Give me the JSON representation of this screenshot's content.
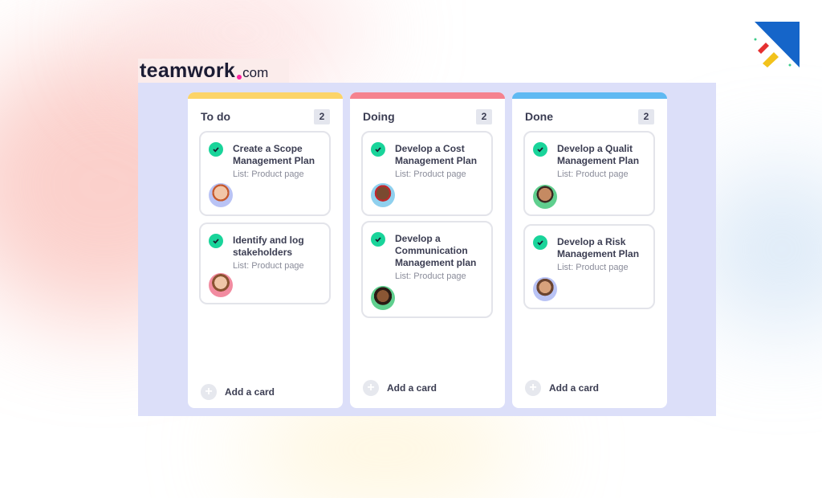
{
  "logo": {
    "word": "teamwork",
    "suffix": "com"
  },
  "brand_icon": "diagonal-stripes-logo",
  "colors": {
    "todo": "#fcd468",
    "doing": "#f5828f",
    "done": "#5fb9f2",
    "check": "#19d49a",
    "board_bg": "#dcdff9"
  },
  "columns": [
    {
      "title": "To do",
      "count": "2",
      "add_label": "Add a card",
      "cards": [
        {
          "title": "Create a Scope Management Plan",
          "list": "List: Product page",
          "avatar": "woman-red-hair-avatar"
        },
        {
          "title": "Identify and log stakeholders",
          "list": "List: Product page",
          "avatar": "woman-brown-hair-avatar"
        }
      ]
    },
    {
      "title": "Doing",
      "count": "2",
      "add_label": "Add a card",
      "cards": [
        {
          "title": "Develop a Cost Management Plan",
          "list": "List: Product page",
          "avatar": "man-smiling-avatar"
        },
        {
          "title": "Develop a Communication Management plan",
          "list": "List: Product page",
          "avatar": "woman-curly-hair-avatar"
        }
      ]
    },
    {
      "title": "Done",
      "count": "2",
      "add_label": "Add a card",
      "cards": [
        {
          "title": "Develop a Qualit Management Plan",
          "list": "List: Product page",
          "avatar": "man-beard-avatar"
        },
        {
          "title": "Develop a Risk Management Plan",
          "list": "List: Product page",
          "avatar": "man-stubble-avatar"
        }
      ]
    }
  ]
}
